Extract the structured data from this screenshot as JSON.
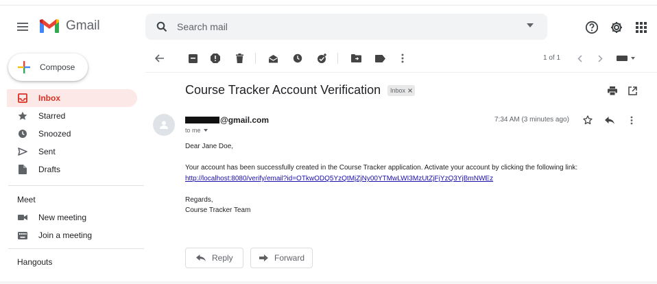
{
  "header": {
    "app_name": "Gmail",
    "search_placeholder": "Search mail"
  },
  "sidebar": {
    "compose_label": "Compose",
    "items": [
      {
        "label": "Inbox",
        "icon": "inbox-icon",
        "active": true
      },
      {
        "label": "Starred",
        "icon": "star-icon"
      },
      {
        "label": "Snoozed",
        "icon": "clock-icon"
      },
      {
        "label": "Sent",
        "icon": "send-icon"
      },
      {
        "label": "Drafts",
        "icon": "draft-icon"
      }
    ],
    "meet": {
      "heading": "Meet",
      "items": [
        {
          "label": "New meeting",
          "icon": "video-icon"
        },
        {
          "label": "Join a meeting",
          "icon": "keyboard-icon"
        }
      ]
    },
    "hangouts_heading": "Hangouts"
  },
  "toolbar": {
    "pagination": "1 of 1"
  },
  "message": {
    "subject": "Course Tracker Account Verification",
    "label_chip": "Inbox",
    "sender_domain": "@gmail.com",
    "recipient": "to me",
    "time": "7:34 AM (3 minutes ago)",
    "greeting": "Dear Jane  Doe,",
    "body": "Your account has been successfully created in the Course Tracker application. Activate your account by clicking the following link:",
    "link": "http://localhost:8080/verify/email?id=OTkwODQ5YzQtMjZjNy00YTMwLWI3MzUtZjFjYzQ3YjBmNWEz",
    "closing": "Regards,",
    "signature": "Course Tracker Team"
  },
  "actions": {
    "reply_label": "Reply",
    "forward_label": "Forward"
  },
  "colors": {
    "accent_red": "#d93025",
    "active_bg": "#fce8e6",
    "link": "#1a0dab"
  }
}
